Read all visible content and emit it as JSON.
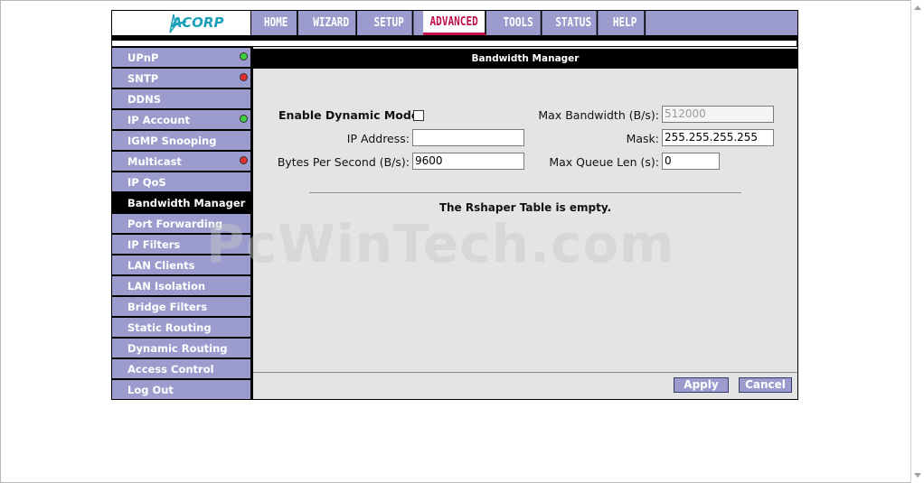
{
  "brand": {
    "logo": "ACORP"
  },
  "nav": {
    "items": [
      {
        "label": "HOME"
      },
      {
        "label": "WIZARD"
      },
      {
        "label": "SETUP"
      },
      {
        "label": "ADVANCED"
      },
      {
        "label": "TOOLS"
      },
      {
        "label": "STATUS"
      },
      {
        "label": "HELP"
      }
    ],
    "active": "ADVANCED",
    "active_color": "#c0104c"
  },
  "sidebar": {
    "items": [
      {
        "label": "UPnP",
        "status": "green"
      },
      {
        "label": "SNTP",
        "status": "red"
      },
      {
        "label": "DDNS"
      },
      {
        "label": "IP Account",
        "status": "green"
      },
      {
        "label": "IGMP Snooping"
      },
      {
        "label": "Multicast",
        "status": "red"
      },
      {
        "label": "IP QoS"
      },
      {
        "label": "Bandwidth Manager"
      },
      {
        "label": "Port Forwarding"
      },
      {
        "label": "IP Filters"
      },
      {
        "label": "LAN Clients"
      },
      {
        "label": "LAN Isolation"
      },
      {
        "label": "Bridge Filters"
      },
      {
        "label": "Static Routing"
      },
      {
        "label": "Dynamic Routing"
      },
      {
        "label": "Access Control"
      },
      {
        "label": "Log Out"
      }
    ],
    "active": "Bandwidth Manager"
  },
  "main": {
    "title": "Bandwidth Manager",
    "form": {
      "enable_dynamic_label": "Enable Dynamic Mode:",
      "enable_dynamic_checked": false,
      "max_bandwidth_label": "Max Bandwidth (B/s):",
      "max_bandwidth_value": "512000",
      "ip_address_label": "IP Address:",
      "ip_address_value": "",
      "mask_label": "Mask:",
      "mask_value": "255.255.255.255",
      "bps_label": "Bytes Per Second (B/s):",
      "bps_value": "9600",
      "max_queue_label": "Max Queue Len (s):",
      "max_queue_value": "0"
    },
    "empty_message": "The Rshaper Table is empty.",
    "apply_label": "Apply",
    "cancel_label": "Cancel"
  },
  "watermark": "PcWinTech.com",
  "colors": {
    "menu": "#9b9bce",
    "green": "#3ecf3e",
    "red": "#e23030"
  }
}
